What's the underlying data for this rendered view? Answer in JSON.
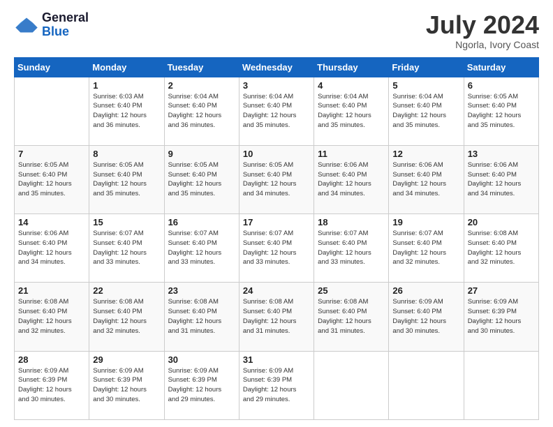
{
  "logo": {
    "text_general": "General",
    "text_blue": "Blue"
  },
  "title": "July 2024",
  "subtitle": "Ngorla, Ivory Coast",
  "weekdays": [
    "Sunday",
    "Monday",
    "Tuesday",
    "Wednesday",
    "Thursday",
    "Friday",
    "Saturday"
  ],
  "weeks": [
    [
      {
        "day": "",
        "info": ""
      },
      {
        "day": "1",
        "info": "Sunrise: 6:03 AM\nSunset: 6:40 PM\nDaylight: 12 hours\nand 36 minutes."
      },
      {
        "day": "2",
        "info": "Sunrise: 6:04 AM\nSunset: 6:40 PM\nDaylight: 12 hours\nand 36 minutes."
      },
      {
        "day": "3",
        "info": "Sunrise: 6:04 AM\nSunset: 6:40 PM\nDaylight: 12 hours\nand 35 minutes."
      },
      {
        "day": "4",
        "info": "Sunrise: 6:04 AM\nSunset: 6:40 PM\nDaylight: 12 hours\nand 35 minutes."
      },
      {
        "day": "5",
        "info": "Sunrise: 6:04 AM\nSunset: 6:40 PM\nDaylight: 12 hours\nand 35 minutes."
      },
      {
        "day": "6",
        "info": "Sunrise: 6:05 AM\nSunset: 6:40 PM\nDaylight: 12 hours\nand 35 minutes."
      }
    ],
    [
      {
        "day": "7",
        "info": "Sunrise: 6:05 AM\nSunset: 6:40 PM\nDaylight: 12 hours\nand 35 minutes."
      },
      {
        "day": "8",
        "info": "Sunrise: 6:05 AM\nSunset: 6:40 PM\nDaylight: 12 hours\nand 35 minutes."
      },
      {
        "day": "9",
        "info": "Sunrise: 6:05 AM\nSunset: 6:40 PM\nDaylight: 12 hours\nand 35 minutes."
      },
      {
        "day": "10",
        "info": "Sunrise: 6:05 AM\nSunset: 6:40 PM\nDaylight: 12 hours\nand 34 minutes."
      },
      {
        "day": "11",
        "info": "Sunrise: 6:06 AM\nSunset: 6:40 PM\nDaylight: 12 hours\nand 34 minutes."
      },
      {
        "day": "12",
        "info": "Sunrise: 6:06 AM\nSunset: 6:40 PM\nDaylight: 12 hours\nand 34 minutes."
      },
      {
        "day": "13",
        "info": "Sunrise: 6:06 AM\nSunset: 6:40 PM\nDaylight: 12 hours\nand 34 minutes."
      }
    ],
    [
      {
        "day": "14",
        "info": "Sunrise: 6:06 AM\nSunset: 6:40 PM\nDaylight: 12 hours\nand 34 minutes."
      },
      {
        "day": "15",
        "info": "Sunrise: 6:07 AM\nSunset: 6:40 PM\nDaylight: 12 hours\nand 33 minutes."
      },
      {
        "day": "16",
        "info": "Sunrise: 6:07 AM\nSunset: 6:40 PM\nDaylight: 12 hours\nand 33 minutes."
      },
      {
        "day": "17",
        "info": "Sunrise: 6:07 AM\nSunset: 6:40 PM\nDaylight: 12 hours\nand 33 minutes."
      },
      {
        "day": "18",
        "info": "Sunrise: 6:07 AM\nSunset: 6:40 PM\nDaylight: 12 hours\nand 33 minutes."
      },
      {
        "day": "19",
        "info": "Sunrise: 6:07 AM\nSunset: 6:40 PM\nDaylight: 12 hours\nand 32 minutes."
      },
      {
        "day": "20",
        "info": "Sunrise: 6:08 AM\nSunset: 6:40 PM\nDaylight: 12 hours\nand 32 minutes."
      }
    ],
    [
      {
        "day": "21",
        "info": "Sunrise: 6:08 AM\nSunset: 6:40 PM\nDaylight: 12 hours\nand 32 minutes."
      },
      {
        "day": "22",
        "info": "Sunrise: 6:08 AM\nSunset: 6:40 PM\nDaylight: 12 hours\nand 32 minutes."
      },
      {
        "day": "23",
        "info": "Sunrise: 6:08 AM\nSunset: 6:40 PM\nDaylight: 12 hours\nand 31 minutes."
      },
      {
        "day": "24",
        "info": "Sunrise: 6:08 AM\nSunset: 6:40 PM\nDaylight: 12 hours\nand 31 minutes."
      },
      {
        "day": "25",
        "info": "Sunrise: 6:08 AM\nSunset: 6:40 PM\nDaylight: 12 hours\nand 31 minutes."
      },
      {
        "day": "26",
        "info": "Sunrise: 6:09 AM\nSunset: 6:40 PM\nDaylight: 12 hours\nand 30 minutes."
      },
      {
        "day": "27",
        "info": "Sunrise: 6:09 AM\nSunset: 6:39 PM\nDaylight: 12 hours\nand 30 minutes."
      }
    ],
    [
      {
        "day": "28",
        "info": "Sunrise: 6:09 AM\nSunset: 6:39 PM\nDaylight: 12 hours\nand 30 minutes."
      },
      {
        "day": "29",
        "info": "Sunrise: 6:09 AM\nSunset: 6:39 PM\nDaylight: 12 hours\nand 30 minutes."
      },
      {
        "day": "30",
        "info": "Sunrise: 6:09 AM\nSunset: 6:39 PM\nDaylight: 12 hours\nand 29 minutes."
      },
      {
        "day": "31",
        "info": "Sunrise: 6:09 AM\nSunset: 6:39 PM\nDaylight: 12 hours\nand 29 minutes."
      },
      {
        "day": "",
        "info": ""
      },
      {
        "day": "",
        "info": ""
      },
      {
        "day": "",
        "info": ""
      }
    ]
  ]
}
